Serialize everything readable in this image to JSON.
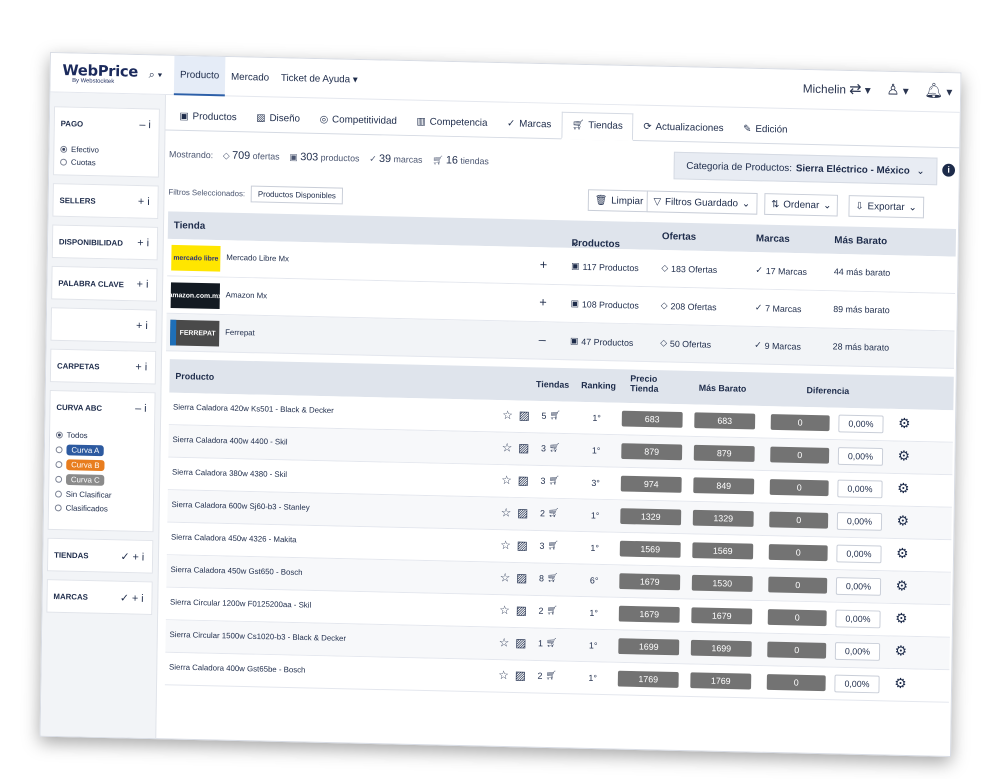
{
  "brand": {
    "name": "WebPrice",
    "sub": "By Webstocktek"
  },
  "topnav": {
    "items": [
      "Producto",
      "Mercado",
      "Ticket de Ayuda"
    ]
  },
  "user": {
    "name": "Michelin"
  },
  "sidebar": [
    {
      "label": "PAGO",
      "control": "– i",
      "options": [
        "Efectivo",
        "Cuotas"
      ]
    },
    {
      "label": "SELLERS",
      "control": "+ i"
    },
    {
      "label": "DISPONIBILIDAD",
      "control": "+ i"
    },
    {
      "label": "PALABRA CLAVE",
      "control": "+ i"
    },
    {
      "label": "",
      "control": "+ i"
    },
    {
      "label": "CARPETAS",
      "control": "+ i"
    },
    {
      "label": "CURVA ABC",
      "control": "– i",
      "options": [
        "Todos",
        "Curva A",
        "Curva B",
        "Curva C",
        "Sin Clasificar",
        "Clasificados"
      ]
    },
    {
      "label": "TIENDAS",
      "control": "✓ + i"
    },
    {
      "label": "MARCAS",
      "control": "✓ + i"
    }
  ],
  "curva_colors": {
    "a": "#2d5aa0",
    "b": "#e87d1e",
    "c": "#8b8b8b"
  },
  "tabs": [
    "Productos",
    "Diseño",
    "Competitividad",
    "Competencia",
    "Marcas",
    "Tiendas",
    "Actualizaciones",
    "Edición"
  ],
  "stats": {
    "label": "Mostrando:",
    "ofertas": "709",
    "ofertas_l": "ofertas",
    "productos": "303",
    "productos_l": "productos",
    "marcas": "39",
    "marcas_l": "marcas",
    "tiendas": "16",
    "tiendas_l": "tiendas"
  },
  "category": {
    "label": "Categoria de Productos:",
    "value": "Sierra Eléctrico - México"
  },
  "filters": {
    "label": "Filtros Seleccionados:",
    "chip": "Productos Disponibles"
  },
  "buttons": {
    "limpiar": "Limpiar",
    "guardado": "Filtros Guardado",
    "ordenar": "Ordenar",
    "exportar": "Exportar"
  },
  "stores_header": {
    "tienda": "Tienda",
    "productos": "Productos",
    "ofertas": "Ofertas",
    "marcas": "Marcas",
    "barato": "Más Barato"
  },
  "stores": [
    {
      "name": "Mercado Libre Mx",
      "logo": "mercado libre",
      "toggle": "+",
      "productos": "117 Productos",
      "ofertas": "183 Ofertas",
      "marcas": "17 Marcas",
      "barato": "44 más barato"
    },
    {
      "name": "Amazon Mx",
      "logo": "amazon.com.mx",
      "toggle": "+",
      "productos": "108 Productos",
      "ofertas": "208 Ofertas",
      "marcas": "7 Marcas",
      "barato": "89 más barato"
    },
    {
      "name": "Ferrepat",
      "logo": "FERREPAT",
      "toggle": "–",
      "productos": "47 Productos",
      "ofertas": "50 Ofertas",
      "marcas": "9 Marcas",
      "barato": "28 más barato"
    }
  ],
  "products_header": {
    "producto": "Producto",
    "tiendas": "Tiendas",
    "ranking": "Ranking",
    "precio": "Precio Tienda",
    "barato": "Más Barato",
    "diferencia": "Diferencia"
  },
  "products": [
    {
      "name": "Sierra Caladora 420w Ks501 - Black & Decker",
      "tiendas": "5",
      "ranking": "1°",
      "precio": "683",
      "barato": "683",
      "dif": "0",
      "pct": "0,00%"
    },
    {
      "name": "Sierra Caladora 400w 4400 - Skil",
      "tiendas": "3",
      "ranking": "1°",
      "precio": "879",
      "barato": "879",
      "dif": "0",
      "pct": "0,00%"
    },
    {
      "name": "Sierra Caladora 380w 4380 - Skil",
      "tiendas": "3",
      "ranking": "3°",
      "precio": "974",
      "barato": "849",
      "dif": "0",
      "pct": "0,00%"
    },
    {
      "name": "Sierra Caladora 600w Sj60-b3 - Stanley",
      "tiendas": "2",
      "ranking": "1°",
      "precio": "1329",
      "barato": "1329",
      "dif": "0",
      "pct": "0,00%"
    },
    {
      "name": "Sierra Caladora 450w 4326 - Makita",
      "tiendas": "3",
      "ranking": "1°",
      "precio": "1569",
      "barato": "1569",
      "dif": "0",
      "pct": "0,00%"
    },
    {
      "name": "Sierra Caladora 450w Gst650 - Bosch",
      "tiendas": "8",
      "ranking": "6°",
      "precio": "1679",
      "barato": "1530",
      "dif": "0",
      "pct": "0,00%"
    },
    {
      "name": "Sierra Circular 1200w F0125200aa - Skil",
      "tiendas": "2",
      "ranking": "1°",
      "precio": "1679",
      "barato": "1679",
      "dif": "0",
      "pct": "0,00%"
    },
    {
      "name": "Sierra Circular 1500w Cs1020-b3 - Black & Decker",
      "tiendas": "1",
      "ranking": "1°",
      "precio": "1699",
      "barato": "1699",
      "dif": "0",
      "pct": "0,00%"
    },
    {
      "name": "Sierra Caladora 400w Gst65be - Bosch",
      "tiendas": "2",
      "ranking": "1°",
      "precio": "1769",
      "barato": "1769",
      "dif": "0",
      "pct": "0,00%"
    }
  ]
}
